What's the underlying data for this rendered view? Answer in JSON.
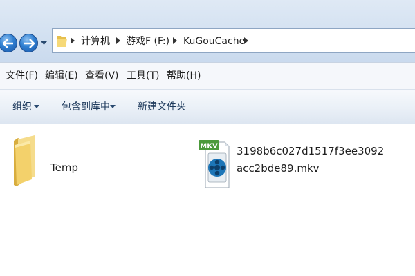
{
  "address": {
    "breadcrumbs": [
      "计算机",
      "游戏F (F:)",
      "KuGouCache"
    ]
  },
  "menu": {
    "items": [
      "文件(F)",
      "编辑(E)",
      "查看(V)",
      "工具(T)",
      "帮助(H)"
    ]
  },
  "commands": {
    "organize": "组织",
    "include_in_library": "包含到库中",
    "new_folder": "新建文件夹"
  },
  "files": [
    {
      "name": "Temp",
      "icon": "folder-icon"
    },
    {
      "name": "3198b6c027d1517f3ee3092acc2bde89.mkv",
      "icon": "mkv-video-file-icon",
      "badge": "MKV"
    }
  ],
  "colors": {
    "nav_button": "#2f7fd1",
    "folder": "#f3d16b",
    "mkv_badge": "#4c9a3c",
    "mkv_reel": "#1d76b8"
  }
}
